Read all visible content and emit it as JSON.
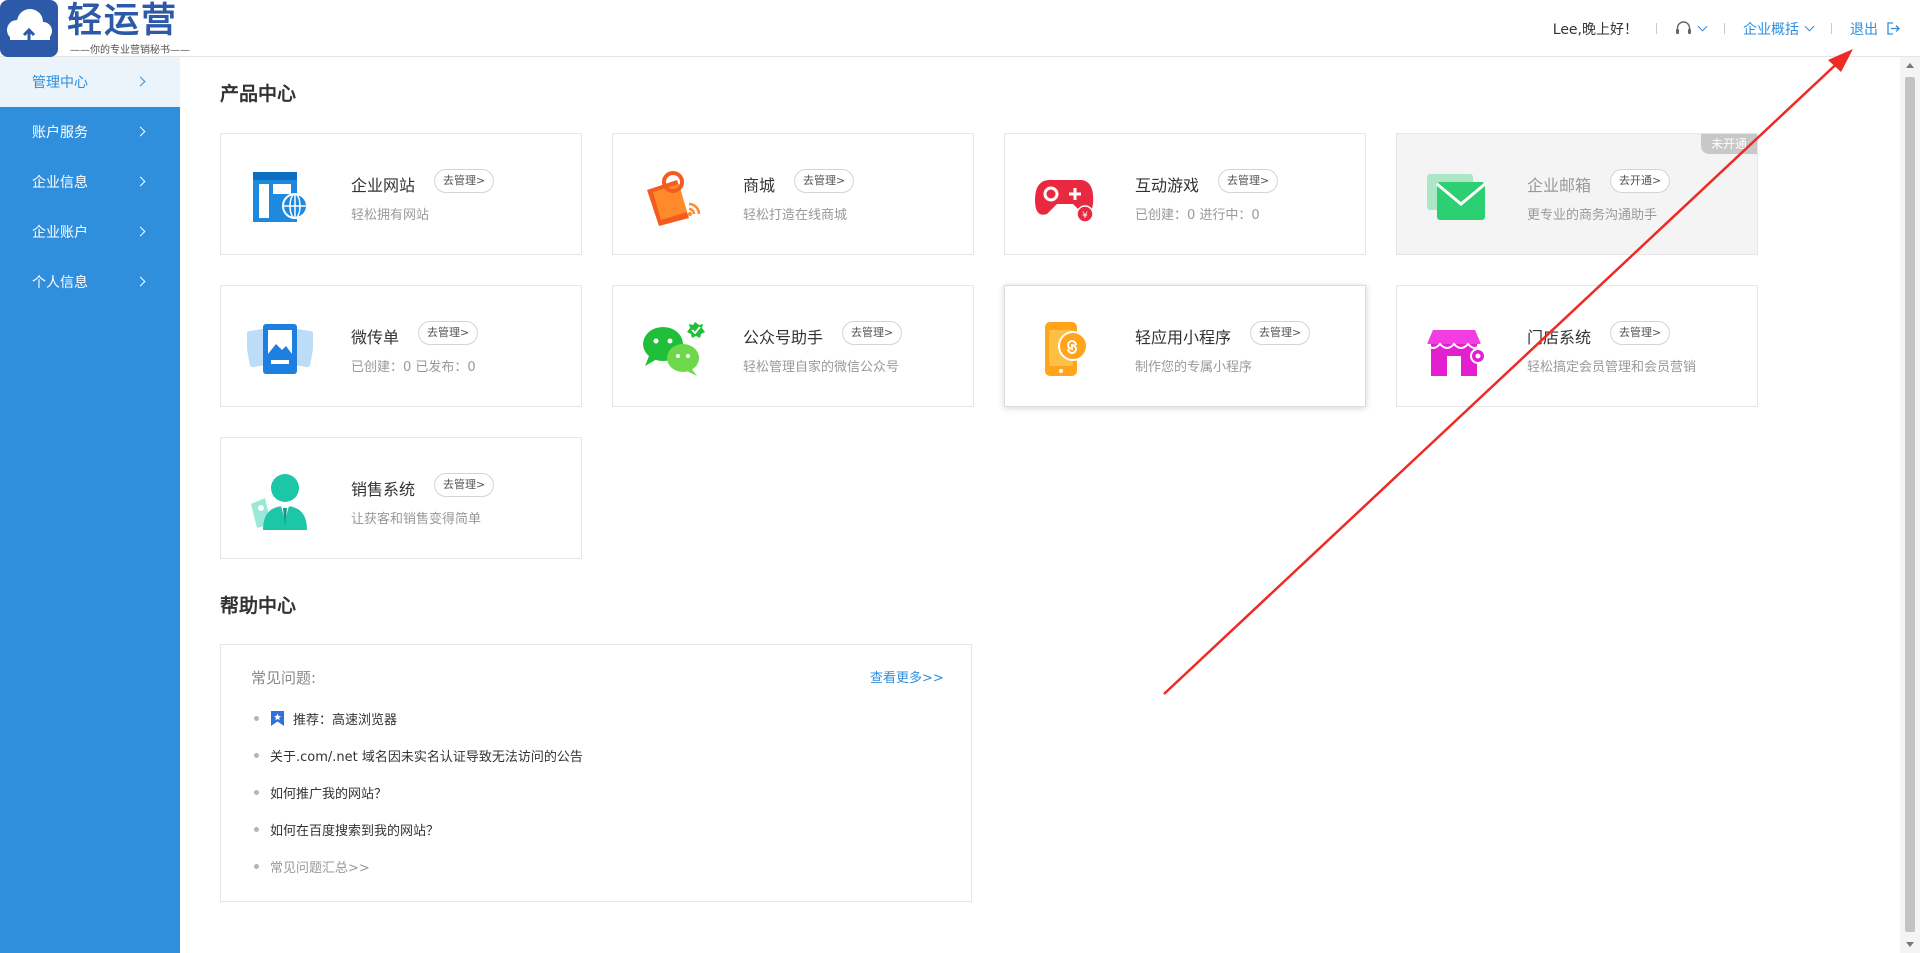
{
  "brand": {
    "title": "轻运营",
    "slogan": "——你的专业营销秘书——"
  },
  "header": {
    "greeting": "Lee,晚上好！",
    "overview_label": "企业概括",
    "logout_label": "退出",
    "accent_color": "#2f8fdc"
  },
  "sidebar": {
    "items": [
      {
        "label": "管理中心",
        "active": true
      },
      {
        "label": "账户服务"
      },
      {
        "label": "企业信息"
      },
      {
        "label": "企业账户"
      },
      {
        "label": "个人信息"
      }
    ]
  },
  "products": {
    "title": "产品中心",
    "cards": [
      {
        "name": "企业网站",
        "action": "去管理>",
        "desc": "轻松拥有网站",
        "icon": "website-icon"
      },
      {
        "name": "商城",
        "action": "去管理>",
        "desc": "轻松打造在线商城",
        "icon": "mall-icon"
      },
      {
        "name": "互动游戏",
        "action": "去管理>",
        "desc": "已创建：0    进行中：0",
        "icon": "game-icon"
      },
      {
        "name": "企业邮箱",
        "action": "去开通>",
        "desc": "更专业的商务沟通助手",
        "badge": "未开通",
        "icon": "mail-icon"
      },
      {
        "name": "微传单",
        "action": "去管理>",
        "desc": "已创建：0    已发布：0",
        "icon": "flyer-icon"
      },
      {
        "name": "公众号助手",
        "action": "去管理>",
        "desc": "轻松管理自家的微信公众号",
        "icon": "wechat-icon"
      },
      {
        "name": "轻应用小程序",
        "action": "去管理>",
        "desc": "制作您的专属小程序",
        "icon": "miniapp-icon"
      },
      {
        "name": "门店系统",
        "action": "去管理>",
        "desc": "轻松搞定会员管理和会员营销",
        "icon": "store-icon"
      },
      {
        "name": "销售系统",
        "action": "去管理>",
        "desc": "让获客和销售变得简单",
        "icon": "sales-icon"
      }
    ]
  },
  "help": {
    "title": "帮助中心",
    "faq_heading": "常见问题:",
    "more_label": "查看更多>>",
    "items": [
      {
        "text": "推荐：高速浏览器",
        "icon": "bookmark-star-icon"
      },
      {
        "text": "关于.com/.net 域名因未实名认证导致无法访问的公告"
      },
      {
        "text": "如何推广我的网站？"
      },
      {
        "text": "如何在百度搜索到我的网站？"
      },
      {
        "text": "常见问题汇总>>",
        "muted": true
      }
    ]
  }
}
